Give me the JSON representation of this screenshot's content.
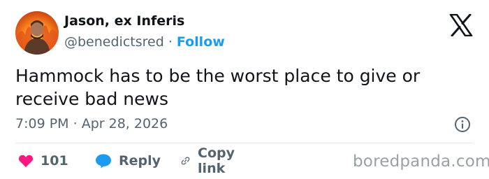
{
  "tweet": {
    "author_name": "Jason, ex Inferis",
    "handle": "@benedictsred",
    "separator": "·",
    "follow_label": "Follow",
    "text": "Hammock has to be the worst place to give or receive bad news",
    "time": "7:09 PM",
    "date": "Apr 28, 2026"
  },
  "actions": {
    "like_count": "101",
    "reply_label": "Reply",
    "copy_link_label": "Copy link"
  },
  "icons": {
    "platform": "x-logo-icon",
    "info": "info-icon",
    "like": "heart-icon",
    "reply": "speech-bubble-icon",
    "copy": "link-icon"
  },
  "colors": {
    "follow": "#1d9bf0",
    "like": "#f91880",
    "reply": "#1d9bf0",
    "muted": "#536471"
  },
  "watermark": "boredpanda.com"
}
